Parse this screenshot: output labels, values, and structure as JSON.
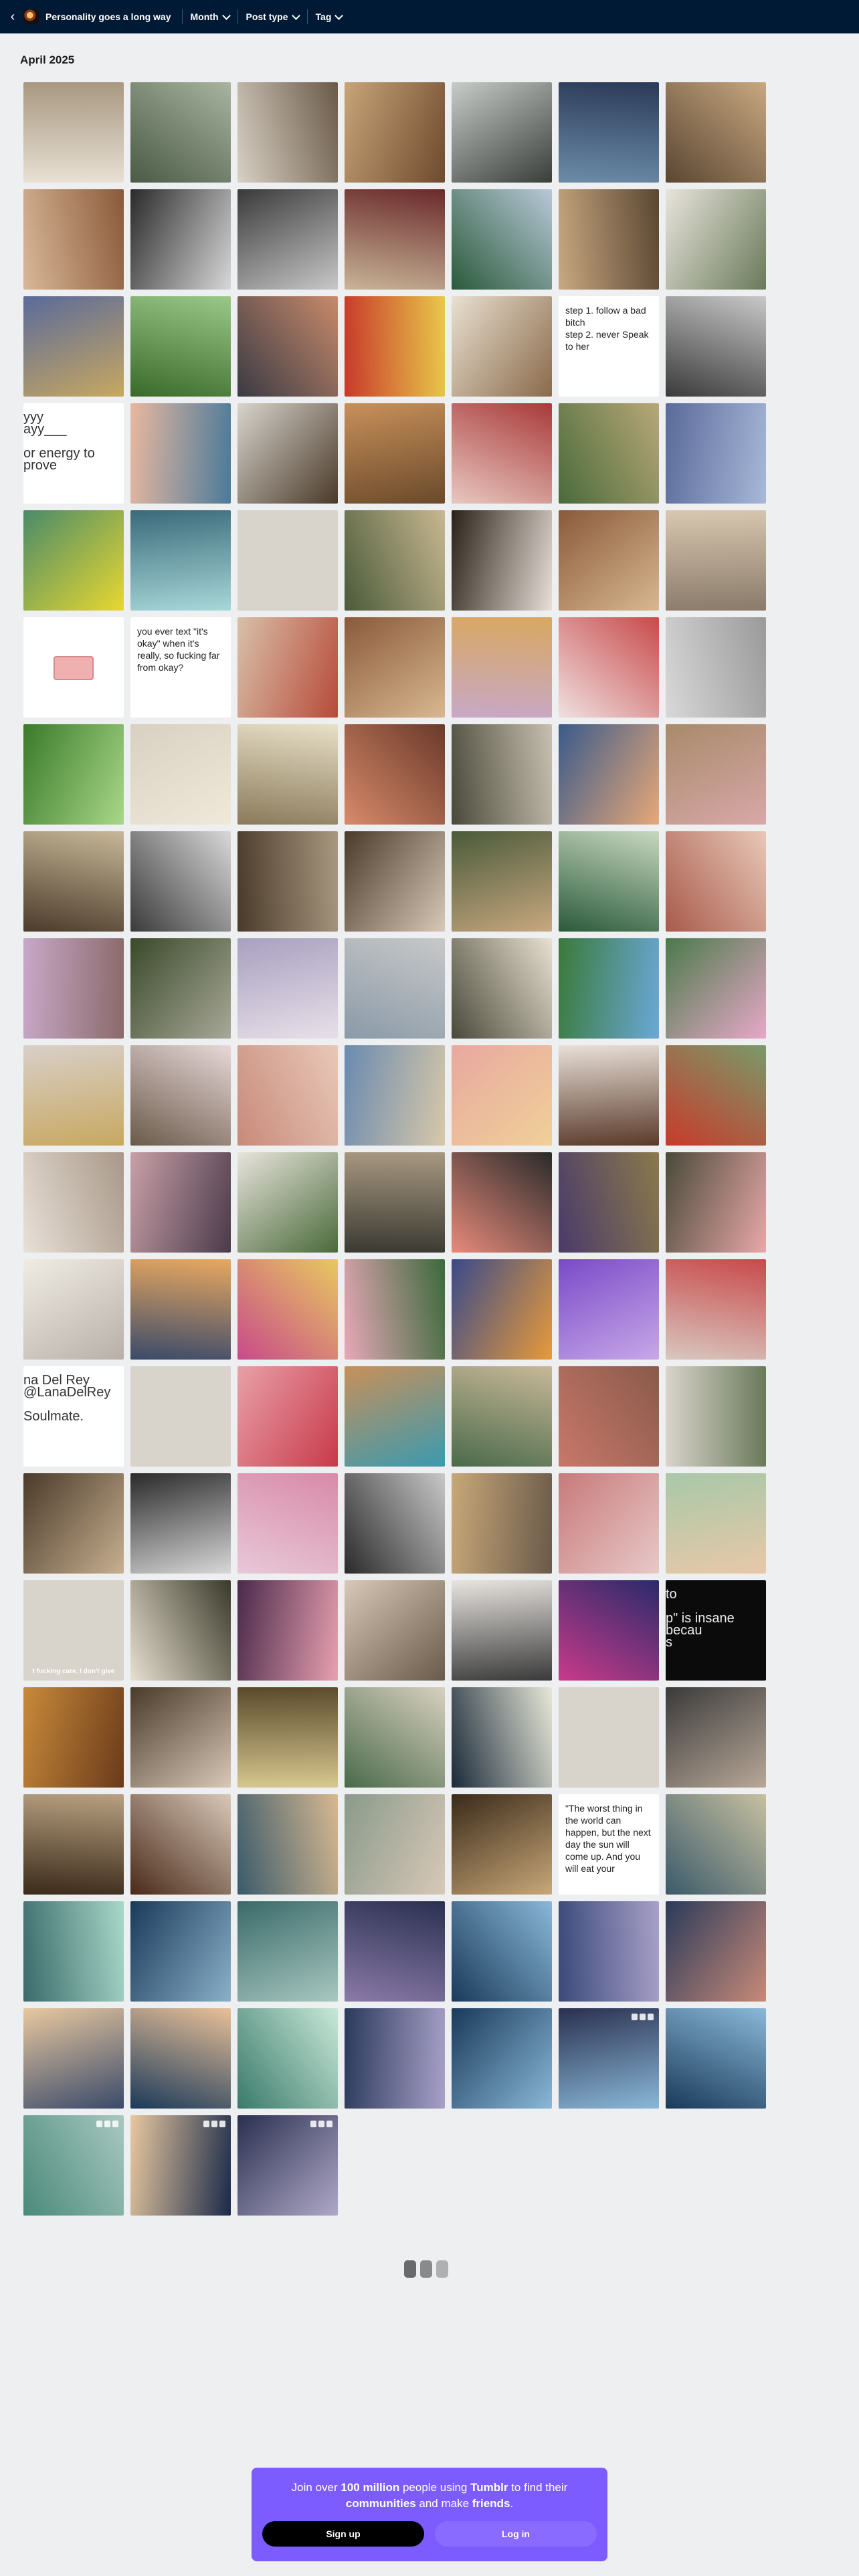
{
  "topbar": {
    "blog_name": "Personality goes a long way",
    "filters": [
      "Month",
      "Post type",
      "Tag"
    ]
  },
  "month_label": "April 2025",
  "tile_text": {
    "t20": "step 1. follow a bad bitch\nstep 2. never Speak to her",
    "t21": "yyy\nayy___\n\nor energy to prove",
    "t37": "you ever text \"it's okay\" when it's really, so fucking far from okay?",
    "t85": "na Del Rey\n@LanaDelRey\n\nSoulmate.",
    "t99": "t fucking care. I don't give",
    "t105": "to\n\np\" is insane becau\ns",
    "t118": "\"The worst thing in the world can happen, but the next day the sun will come up. And you will eat your"
  },
  "banner": {
    "pre": "Join over ",
    "count": "100 million",
    "mid": " people using ",
    "brand": "Tumblr",
    "post": " to find their",
    "l2a": "communities",
    "l2b": " and make ",
    "l2c": "friends",
    "l2d": ".",
    "signup": "Sign up",
    "login": "Log in"
  },
  "colors": {
    "topbar": "#001935",
    "banner": "#7c5cff",
    "page_bg": "#eeeff1"
  }
}
